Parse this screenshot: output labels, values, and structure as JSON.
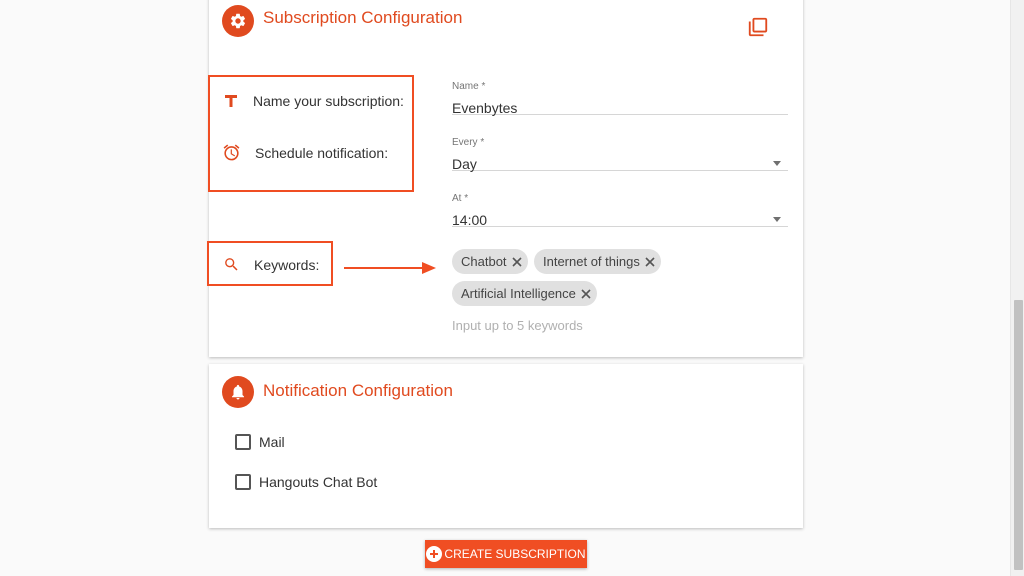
{
  "subscription": {
    "title": "Subscription Configuration",
    "name_label": "Name your subscription:",
    "schedule_label": "Schedule notification:",
    "keywords_label": "Keywords:",
    "fields": {
      "name": {
        "label": "Name *",
        "value": "Evenbytes"
      },
      "every": {
        "label": "Every *",
        "value": "Day"
      },
      "at": {
        "label": "At *",
        "value": "14:00"
      }
    },
    "chips": [
      "Chatbot",
      "Internet of things",
      "Artificial Intelligence"
    ],
    "keywords_hint": "Input up to 5 keywords"
  },
  "notification": {
    "title": "Notification Configuration",
    "options": [
      "Mail",
      "Hangouts Chat Bot"
    ]
  },
  "actions": {
    "create_label": "CREATE SUBSCRIPTION"
  },
  "colors": {
    "accent": "#e04a1f",
    "highlight": "#f04e23"
  }
}
